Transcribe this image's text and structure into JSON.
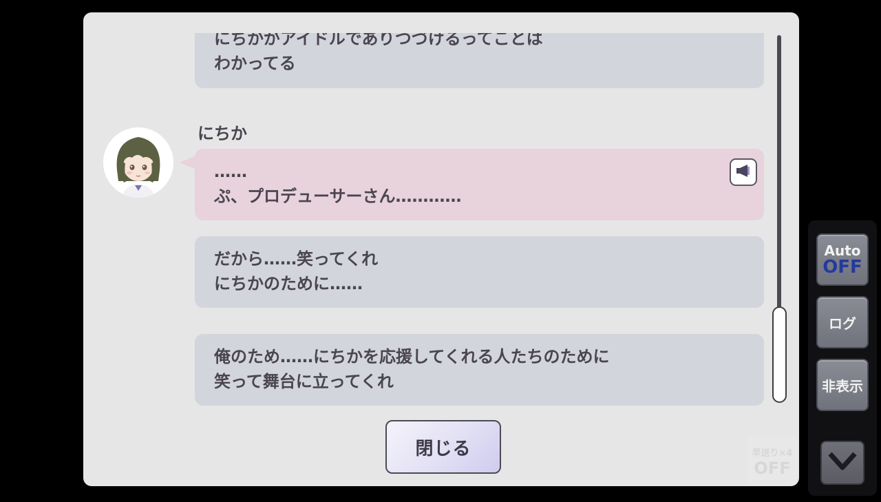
{
  "log": {
    "entries": [
      {
        "speaker": "",
        "lines": [
          "にちかがアイドルでありつづけるってことは",
          "わかってる"
        ],
        "style": "gray"
      },
      {
        "speaker": "にちか",
        "lines": [
          "……",
          "ぷ、プロデューサーさん…………"
        ],
        "style": "pink",
        "has_voice": true,
        "avatar_icon": "nichika-avatar-icon"
      },
      {
        "speaker": "",
        "lines": [
          "だから……笑ってくれ",
          "にちかのために……"
        ],
        "style": "gray"
      },
      {
        "speaker": "",
        "lines": [
          "俺のため……にちかを応援してくれる人たちのために",
          "笑って舞台に立ってくれ"
        ],
        "style": "gray"
      }
    ],
    "close_label": "閉じる"
  },
  "fast_forward": {
    "top": "早送り×4",
    "bottom": "OFF"
  },
  "side_menu": {
    "auto_label": "Auto",
    "auto_state": "OFF",
    "log_label": "ログ",
    "hide_label": "非表示",
    "down_icon": "chevron-down-icon"
  },
  "colors": {
    "panel_bg": "#e6e6e6",
    "bubble_gray": "#d3d5dc",
    "bubble_pink": "#e8d2dc",
    "text": "#4a4550",
    "auto_off": "#243a9c"
  }
}
